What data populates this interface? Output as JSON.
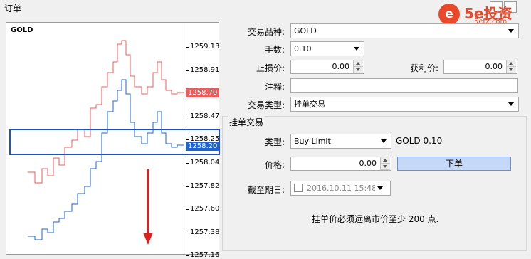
{
  "window": {
    "title": "订单"
  },
  "watermark": {
    "logo_char": "e",
    "text": "5e投资",
    "sub": "5etz.com"
  },
  "chart": {
    "symbol": "GOLD",
    "ask_price": "1258.70",
    "bid_price": "1258.20",
    "ask_color": "#f05a5a",
    "bid_color": "#1e64d2",
    "ticks": [
      "1259.13",
      "1258.91",
      "1258.70",
      "1258.47",
      "1258.25",
      "1258.04",
      "1257.82",
      "1257.60",
      "1257.38",
      "1257.16"
    ]
  },
  "form": {
    "symbol_label": "交易品种:",
    "symbol_value": "GOLD",
    "volume_label": "手数:",
    "volume_value": "0.10",
    "sl_label": "止损价:",
    "sl_value": "0.00",
    "tp_label": "获利价:",
    "tp_value": "0.00",
    "comment_label": "注释:",
    "comment_value": "",
    "type_label": "交易类型:",
    "type_value": "挂单交易"
  },
  "pending": {
    "group_title": "挂单交易",
    "type_label": "类型:",
    "type_value": "Buy Limit",
    "type_info": "GOLD 0.10",
    "price_label": "价格:",
    "price_value": "0.00",
    "place_button": "下单",
    "expiry_label": "截至期日:",
    "expiry_value": "2016.10.11 15:48",
    "note": "挂单价必须远离市价至少 200 点."
  }
}
